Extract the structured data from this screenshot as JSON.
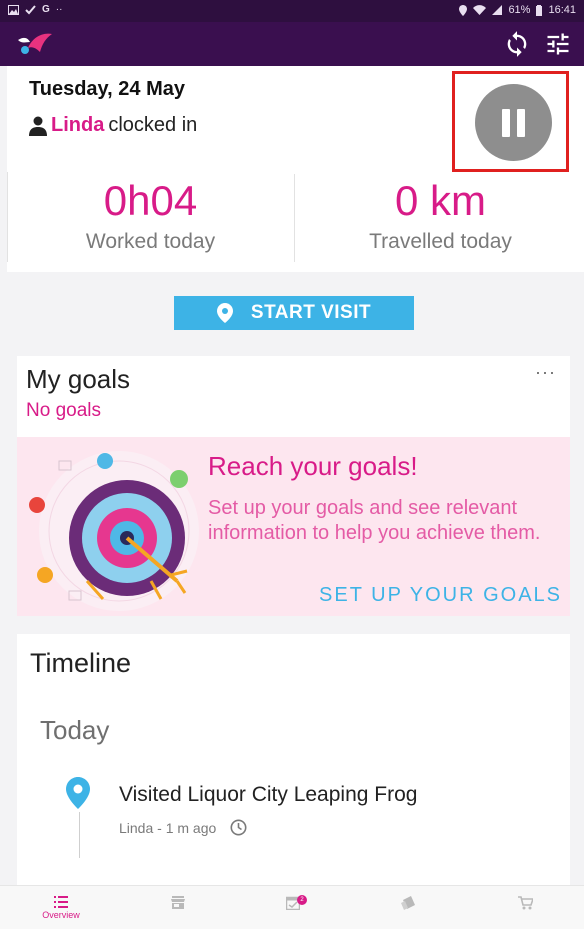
{
  "status_bar": {
    "left_icons": [
      "image-icon",
      "check-icon",
      "google-icon",
      "more-icon"
    ],
    "google_glyph": "G",
    "more_glyph": "··",
    "battery": "61%",
    "time": "16:41"
  },
  "app_bar": {
    "icons": [
      "logo-icon",
      "sync-icon",
      "filter-icon"
    ],
    "brand_color": "#3a0f4f"
  },
  "header": {
    "date": "Tuesday, 24 May",
    "user_name": "Linda",
    "clocked_text": "clocked in",
    "worked_value": "0h04",
    "worked_label": "Worked today",
    "travelled_value": "0 km",
    "travelled_label": "Travelled today",
    "accent_color": "#d81b88"
  },
  "start_visit": {
    "label": "START VISIT",
    "color": "#3db3e6"
  },
  "goals": {
    "title": "My goals",
    "more": "···",
    "empty_text": "No goals",
    "banner_title": "Reach your goals!",
    "banner_desc": "Set up your goals and see relevant information to help you achieve them.",
    "setup_link": "SET UP YOUR GOALS"
  },
  "timeline": {
    "title": "Timeline",
    "section": "Today",
    "items": [
      {
        "text": "Visited Liquor City Leaping Frog",
        "meta": "Linda - 1 m ago"
      }
    ]
  },
  "bottom_nav": {
    "items": [
      {
        "label": "Overview",
        "icon": "list-icon",
        "active": true
      },
      {
        "label": "",
        "icon": "store-icon",
        "active": false
      },
      {
        "label": "",
        "icon": "tasks-icon",
        "active": false,
        "badge": "2"
      },
      {
        "label": "",
        "icon": "documents-icon",
        "active": false
      },
      {
        "label": "",
        "icon": "cart-icon",
        "active": false
      }
    ]
  }
}
